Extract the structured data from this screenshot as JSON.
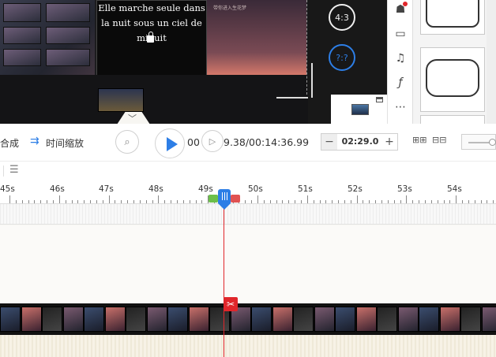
{
  "preview": {
    "caption_line1": "Elle marche seule dans",
    "caption_line2": "la nuit sous un ciel de",
    "caption_line3": "minuit",
    "bg_caption": "带你进入生花梦",
    "ratio_43": "4:3",
    "ratio_custom": "?:?"
  },
  "toolbar": {
    "compose_label": "合成",
    "time_zoom_label": "时间缩放",
    "time_current_prefix": "00",
    "time_display": "9.38/00:14:36.99",
    "duration_minus": "−",
    "duration_value": "02:29.0",
    "duration_plus": "+"
  },
  "ruler": {
    "ticks": [
      "45s",
      "46s",
      "47s",
      "48s",
      "49s",
      "50s",
      "51s",
      "52s",
      "53s",
      "54s"
    ]
  },
  "colors": {
    "accent": "#2d7ee6",
    "playhead": "#e0262b"
  }
}
